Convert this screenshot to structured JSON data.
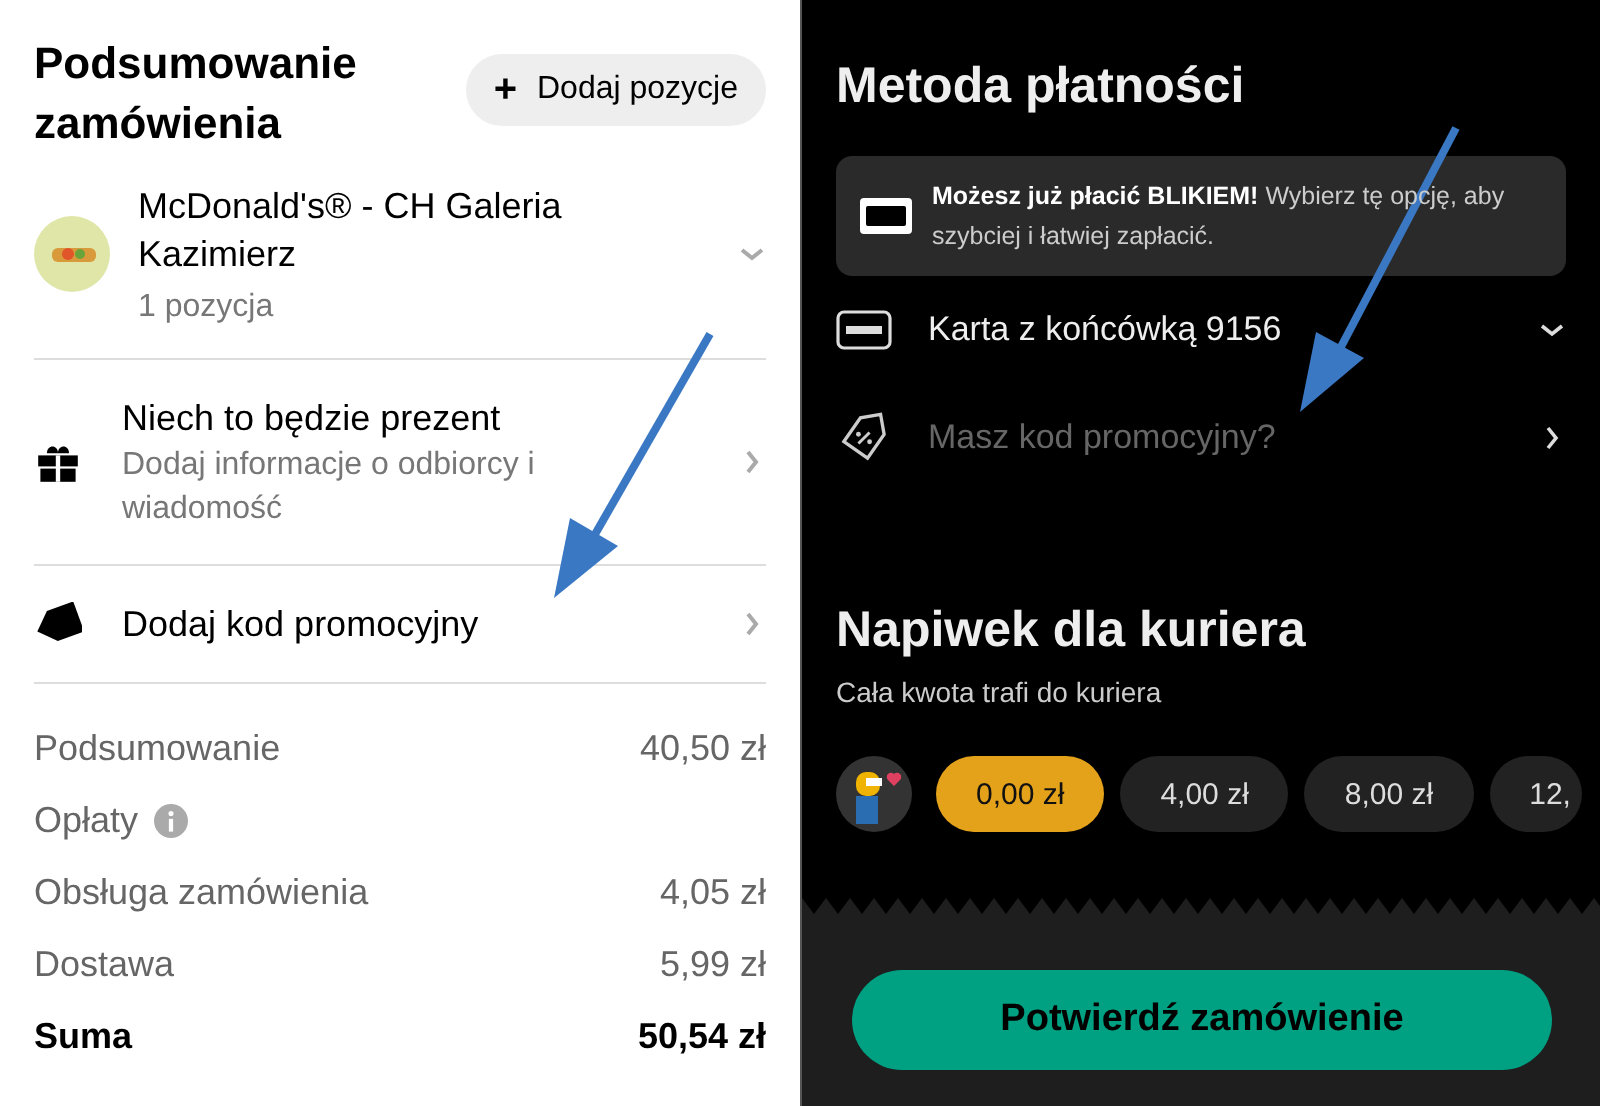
{
  "order_summary": {
    "title": "Podsumowanie zamówienia",
    "add_button": {
      "icon": "+",
      "label": "Dodaj pozycje"
    },
    "restaurant": {
      "name": "McDonald's® - CH Galeria Kazimierz",
      "count": "1 pozycja",
      "expanded": false
    },
    "options": [
      {
        "kind": "gift",
        "title": "Niech to będzie prezent",
        "subtitle": "Dodaj informacje o odbiorcy i wiadomość"
      },
      {
        "kind": "promo",
        "title": "Dodaj kod promocyjny"
      }
    ],
    "lines": [
      {
        "label": "Podsumowanie",
        "value": "40,50 zł",
        "total": false,
        "info": false
      },
      {
        "label": "Opłaty",
        "total": false,
        "info": true
      },
      {
        "label": "Obsługa zamówienia",
        "value": "4,05 zł",
        "total": false,
        "info": false
      },
      {
        "label": "Dostawa",
        "value": "5,99 zł",
        "total": false,
        "info": false
      },
      {
        "label": "Suma",
        "value": "50,54 zł",
        "total": true,
        "info": false
      }
    ]
  },
  "payment": {
    "title": "Metoda płatności",
    "blik_banner": {
      "text": "**Możesz już płacić BLIKIEM!** Wybierz tę opcję, aby szybciej i łatwiej zapłacić."
    },
    "card": {
      "label": "Karta z końcówką 9156",
      "expanded": false
    },
    "promo": {
      "placeholder": "Masz kod promocyjny?"
    }
  },
  "tip": {
    "title": "Napiwek dla kuriera",
    "subtitle": "Cała kwota trafi do kuriera",
    "options": [
      {
        "label": "0,00 zł",
        "selected": true
      },
      {
        "label": "4,00 zł",
        "selected": false
      },
      {
        "label": "8,00 zł",
        "selected": false
      },
      {
        "label": "12,",
        "selected": false
      }
    ]
  },
  "confirm_button": "Potwierdź zamówienie"
}
